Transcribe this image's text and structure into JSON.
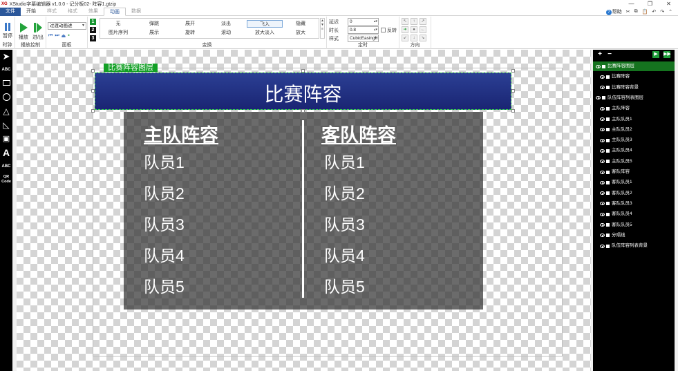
{
  "window": {
    "logo": "XG",
    "title": "XStudio字幕编辑器 v1.0.0 - 记分板02- 阵容1.gtzip",
    "minimize_icon": "minimize-icon",
    "maximize_icon": "maximize-icon",
    "close_icon": "close-icon"
  },
  "menu": {
    "tabs": [
      "文件",
      "开始",
      "样式",
      "格式",
      "效果",
      "动画",
      "数据"
    ],
    "active_tab": "动画",
    "help_label": "帮助",
    "help_icon": "question-icon",
    "right_icons": [
      "cut-icon",
      "copy-icon",
      "paste-icon",
      "undo-icon",
      "redo-icon"
    ]
  },
  "ribbon": {
    "clock": {
      "pause_label": "暂停",
      "group_label": "时钟"
    },
    "playback": {
      "play_label": "播放",
      "step_in_label": "进/出",
      "group_label": "播放控制"
    },
    "panel": {
      "dropdown_value": "过渡动画进",
      "group_label": "面板",
      "mini_controls": [
        "⏮",
        "⏭",
        "⏏",
        "▪"
      ]
    },
    "transform": {
      "numbers": [
        "1",
        "2",
        "3"
      ],
      "row1": [
        "无",
        "弹跳",
        "展开",
        "淡出",
        "飞入",
        "隐藏"
      ],
      "row2": [
        "图片序列",
        "展示",
        "旋转",
        "滚动",
        "放大淡入",
        "放大"
      ],
      "selected": "飞入",
      "group_label": "变换"
    },
    "timing": {
      "delay_label": "延迟",
      "delay_value": "0",
      "duration_label": "时长",
      "duration_value": "0.8",
      "style_label": "样式",
      "style_value": "CubicEasingIn",
      "reverse_label": "反转",
      "group_label": "定时"
    },
    "direction": {
      "group_label": "方向",
      "active": "right"
    }
  },
  "tools": [
    "pointer-icon",
    "text-tool-icon",
    "rectangle-tool-icon",
    "ellipse-tool-icon",
    "triangle-tool-icon",
    "right-triangle-tool-icon",
    "image-tool-icon",
    "font-tool-icon",
    "text-width-tool-icon",
    "qr-code-tool-icon"
  ],
  "tool_labels": {
    "text": "ABC",
    "text2": "ABC",
    "qr": "QR Code",
    "font": "A"
  },
  "canvas": {
    "layer_tag": "比赛阵容图层",
    "header_title": "比赛阵容",
    "home": {
      "title": "主队阵容",
      "players": [
        "队员1",
        "队员2",
        "队员3",
        "队员4",
        "队员5"
      ]
    },
    "away": {
      "title": "客队阵容",
      "players": [
        "队员1",
        "队员2",
        "队员3",
        "队员4",
        "队员5"
      ]
    },
    "colors": {
      "header_top": "#2b3f94",
      "header_bottom": "#1a2573",
      "tag": "#13a026"
    }
  },
  "layers": {
    "add_icon": "plus-icon",
    "remove_icon": "minus-icon",
    "play_icon": "play-icon",
    "step_icon": "step-play-icon",
    "items": [
      {
        "name": "比赛阵容图层",
        "selected": true
      },
      {
        "name": "比赛阵容",
        "selected": false
      },
      {
        "name": "比赛阵容背景",
        "selected": false
      },
      {
        "name": "队伍阵容列表图层",
        "selected": false
      },
      {
        "name": "主队阵容",
        "selected": false
      },
      {
        "name": "主队队员1",
        "selected": false
      },
      {
        "name": "主队队员2",
        "selected": false
      },
      {
        "name": "主队队员3",
        "selected": false
      },
      {
        "name": "主队队员4",
        "selected": false
      },
      {
        "name": "主队队员5",
        "selected": false
      },
      {
        "name": "客队阵容",
        "selected": false
      },
      {
        "name": "客队队员1",
        "selected": false
      },
      {
        "name": "客队队员2",
        "selected": false
      },
      {
        "name": "客队队员3",
        "selected": false
      },
      {
        "name": "客队队员4",
        "selected": false
      },
      {
        "name": "客队队员5",
        "selected": false
      },
      {
        "name": "分隔线",
        "selected": false
      },
      {
        "name": "队伍阵容列表背景",
        "selected": false
      }
    ]
  }
}
